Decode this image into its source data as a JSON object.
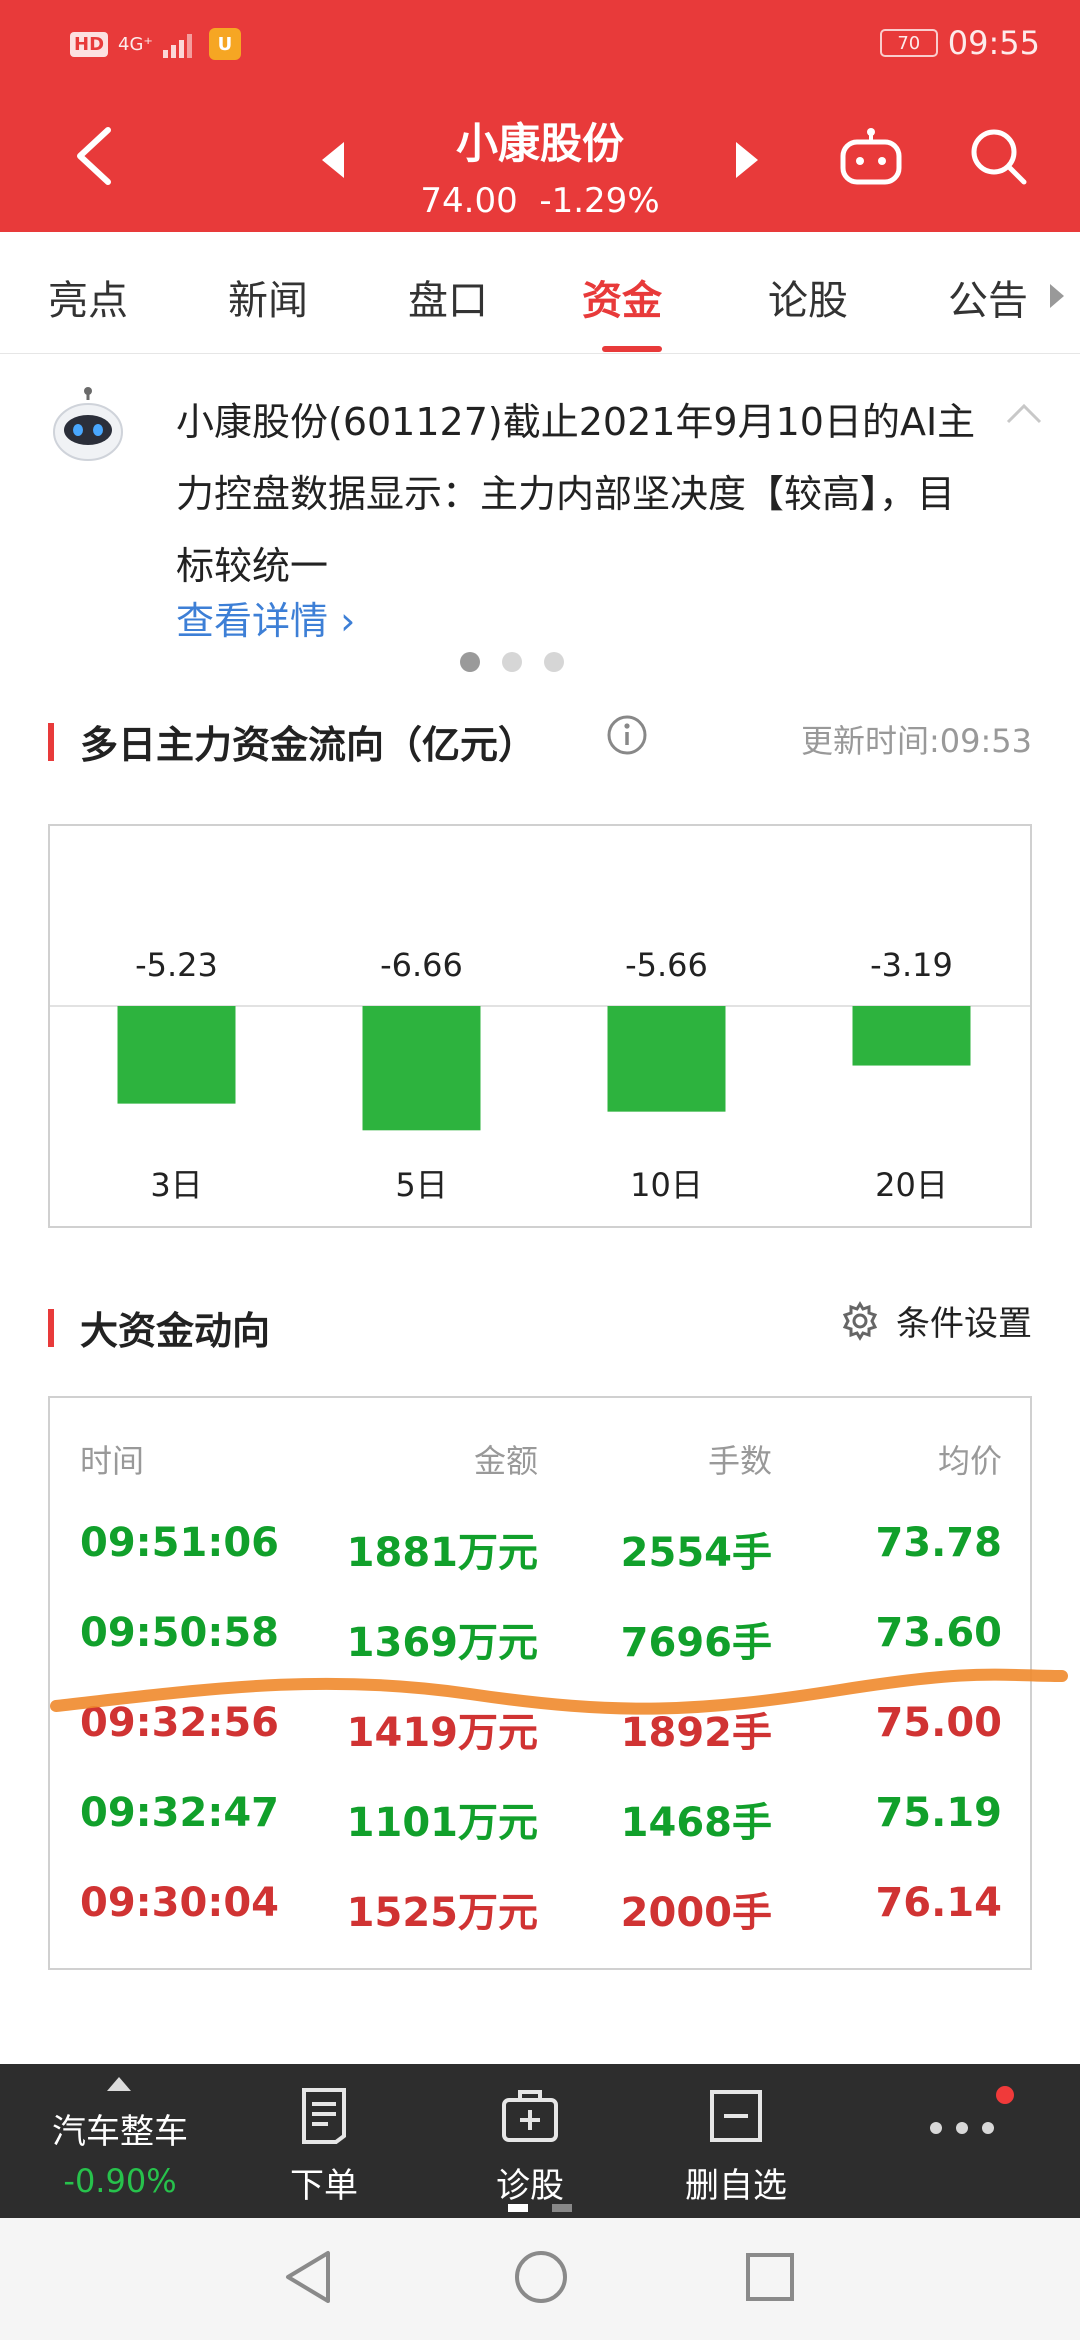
{
  "status_bar": {
    "hd": "HD",
    "signal": "4G⁺",
    "battery": "70",
    "time": "09:55"
  },
  "header": {
    "stock_name": "小康股份",
    "price": "74.00",
    "change_pct": "-1.29%"
  },
  "tabs": [
    {
      "label": "亮点"
    },
    {
      "label": "新闻"
    },
    {
      "label": "盘口"
    },
    {
      "label": "资金",
      "active": true
    },
    {
      "label": "论股"
    },
    {
      "label": "公告"
    }
  ],
  "ai_card": {
    "text": "小康股份(601127)截止2021年9月10日的AI主力控盘数据显示：主力内部坚决度【较高】，目标较统一",
    "link": "查看详情 ›"
  },
  "flow_section": {
    "title": "多日主力资金流向（亿元）",
    "update_time": "更新时间:09:53"
  },
  "chart_data": {
    "type": "bar",
    "categories": [
      "3日",
      "5日",
      "10日",
      "20日"
    ],
    "values": [
      -5.23,
      -6.66,
      -5.66,
      -3.19
    ],
    "value_labels": [
      "-5.23",
      "-6.66",
      "-5.66",
      "-3.19"
    ],
    "ylim": [
      -7.5,
      7.5
    ],
    "bar_color": "#2db33e",
    "title": "多日主力资金流向（亿元）",
    "legend": "none"
  },
  "big_money": {
    "title": "大资金动向",
    "settings_label": "条件设置",
    "headers": [
      "时间",
      "金额",
      "手数",
      "均价"
    ],
    "rows": [
      {
        "time": "09:51:06",
        "amount": "1881万元",
        "lots": "2554手",
        "avg": "73.78",
        "dir": "green"
      },
      {
        "time": "09:50:58",
        "amount": "1369万元",
        "lots": "7696手",
        "avg": "73.60",
        "dir": "green"
      },
      {
        "time": "09:32:56",
        "amount": "1419万元",
        "lots": "1892手",
        "avg": "75.00",
        "dir": "red"
      },
      {
        "time": "09:32:47",
        "amount": "1101万元",
        "lots": "1468手",
        "avg": "75.19",
        "dir": "green"
      },
      {
        "time": "09:30:04",
        "amount": "1525万元",
        "lots": "2000手",
        "avg": "76.14",
        "dir": "red"
      }
    ]
  },
  "bottom_bar": {
    "sector_name": "汽车整车",
    "sector_change": "-0.90%",
    "buttons": [
      {
        "label": "下单"
      },
      {
        "label": "诊股"
      },
      {
        "label": "删自选"
      }
    ]
  },
  "colors": {
    "brand_red": "#e83a3a",
    "up_red": "#d03333",
    "down_green": "#11a02b",
    "link_blue": "#3d7fd6",
    "annotation_orange": "#f08a2c"
  }
}
